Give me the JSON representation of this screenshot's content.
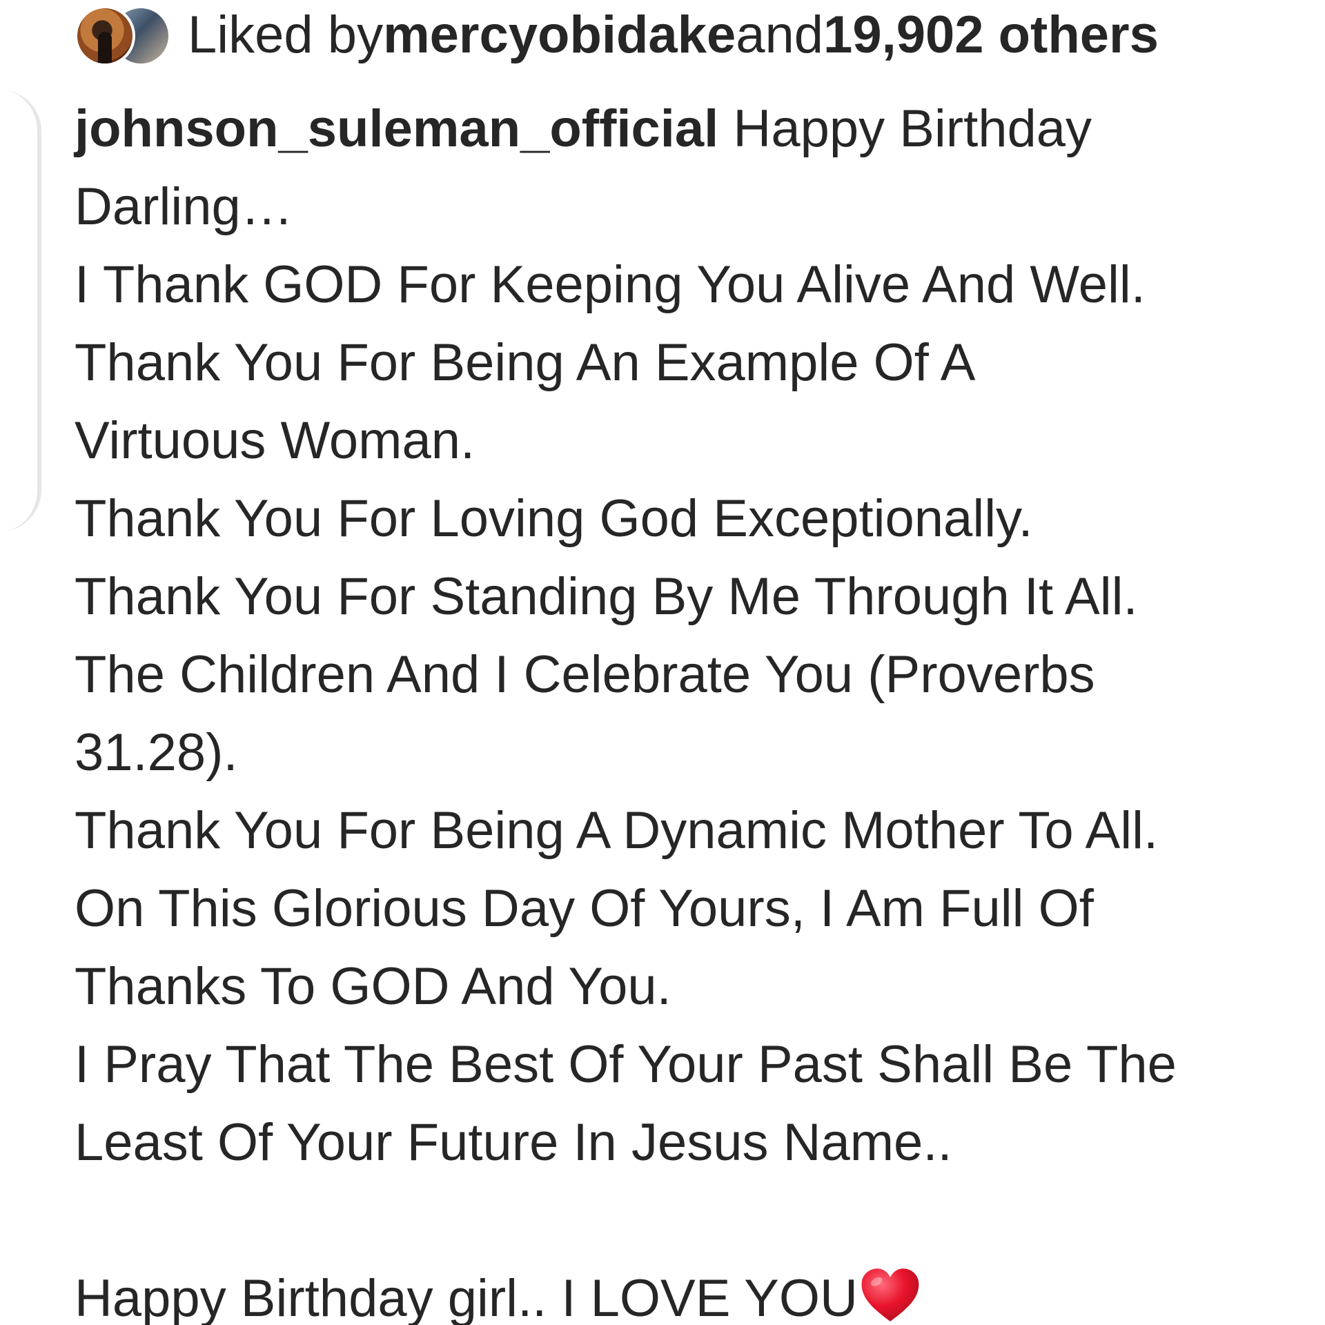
{
  "likes": {
    "prefix": "Liked by ",
    "username": "mercyobidake",
    "middle": " and ",
    "count_text": "19,902 others"
  },
  "caption": {
    "author": "johnson_suleman_official",
    "lines": [
      " Happy Birthday",
      "Darling…",
      "I Thank GOD For Keeping You Alive And Well.",
      "Thank You For Being An Example Of A",
      "Virtuous Woman.",
      "Thank You For Loving God Exceptionally.",
      "Thank You For Standing By Me Through It All.",
      "The Children And I Celebrate You (Proverbs",
      "31.28).",
      "Thank You For Being A Dynamic Mother To All.",
      "On This Glorious Day Of Yours, I Am Full Of",
      "Thanks To GOD And You.",
      "I Pray That The Best Of Your Past Shall Be The",
      "Least Of Your Future In Jesus Name..",
      "",
      "Happy Birthday girl.. I LOVE YOU"
    ],
    "heart_icon": "red-heart-icon",
    "heart_color": "#e8142c"
  }
}
